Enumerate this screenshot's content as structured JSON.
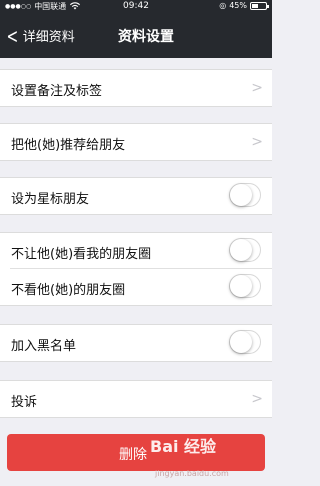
{
  "status_bar": {
    "signal_dots": "●●●○○",
    "carrier": "中国联通",
    "time": "09:42",
    "battery_text": "45%",
    "battery_level": 0.45
  },
  "nav": {
    "back_label": "详细资料",
    "title": "资料设置"
  },
  "groups": {
    "remark": {
      "label": "设置备注及标签"
    },
    "recommend": {
      "label": "把他(她)推荐给朋友"
    },
    "star": {
      "label": "设为星标朋友",
      "on": false
    },
    "moments_block": {
      "label": "不让他(她)看我的朋友圈",
      "on": false
    },
    "moments_hide": {
      "label": "不看他(她)的朋友圈",
      "on": false
    },
    "blacklist": {
      "label": "加入黑名单",
      "on": false
    },
    "complain": {
      "label": "投诉"
    }
  },
  "delete_button": {
    "label": "删除"
  },
  "watermark": {
    "text": "Bai 经验",
    "sub": "jingyan.baidu.com"
  },
  "colors": {
    "nav_bg": "#26292e",
    "danger": "#e64340",
    "page_bg": "#efeff4"
  }
}
